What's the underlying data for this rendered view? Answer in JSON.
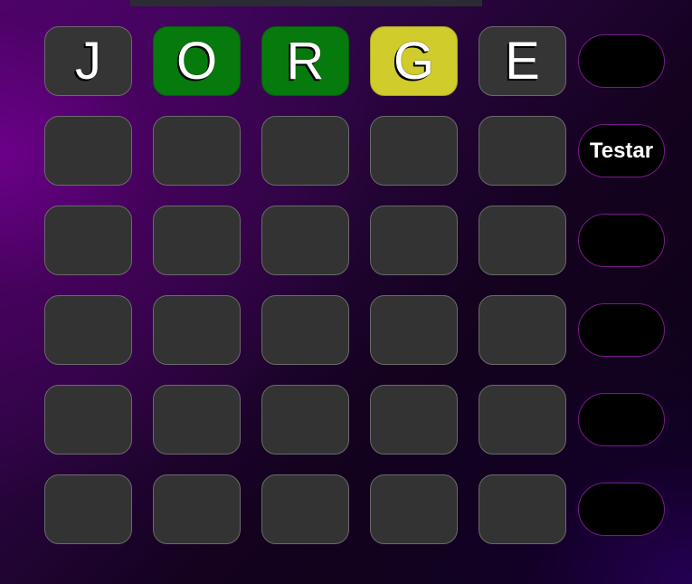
{
  "board": {
    "rows": [
      {
        "letters": [
          "J",
          "O",
          "R",
          "G",
          "E"
        ],
        "states": [
          "absent",
          "correct",
          "correct",
          "present",
          "absent"
        ]
      },
      {
        "letters": [
          "",
          "",
          "",
          "",
          ""
        ],
        "states": [
          "empty",
          "empty",
          "empty",
          "empty",
          "empty"
        ]
      },
      {
        "letters": [
          "",
          "",
          "",
          "",
          ""
        ],
        "states": [
          "empty",
          "empty",
          "empty",
          "empty",
          "empty"
        ]
      },
      {
        "letters": [
          "",
          "",
          "",
          "",
          ""
        ],
        "states": [
          "empty",
          "empty",
          "empty",
          "empty",
          "empty"
        ]
      },
      {
        "letters": [
          "",
          "",
          "",
          "",
          ""
        ],
        "states": [
          "empty",
          "empty",
          "empty",
          "empty",
          "empty"
        ]
      },
      {
        "letters": [
          "",
          "",
          "",
          "",
          ""
        ],
        "states": [
          "empty",
          "empty",
          "empty",
          "empty",
          "empty"
        ]
      }
    ]
  },
  "side_buttons": [
    "",
    "Testar",
    "",
    "",
    "",
    ""
  ],
  "colors": {
    "correct": "#067a0d",
    "present": "#cfcc2b",
    "absent": "#353535",
    "empty": "#333333",
    "button_border": "#7a1a8c"
  }
}
